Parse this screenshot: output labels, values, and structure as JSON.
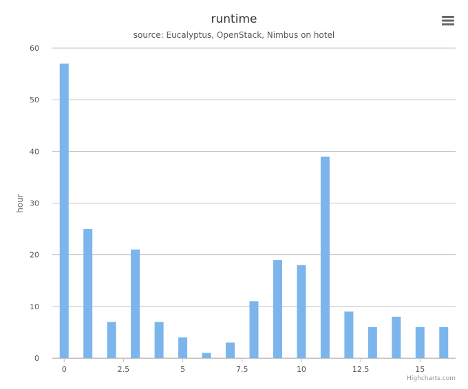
{
  "chart_data": {
    "type": "bar",
    "title": "runtime",
    "subtitle": "source: Eucalyptus, OpenStack, Nimbus on hotel",
    "xlabel": "",
    "ylabel": "hour",
    "x": [
      0,
      1,
      2,
      3,
      4,
      5,
      6,
      7,
      8,
      9,
      10,
      11,
      12,
      13,
      14,
      15,
      16
    ],
    "values": [
      57,
      25,
      7,
      21,
      7,
      4,
      1,
      3,
      11,
      19,
      18,
      39,
      9,
      6,
      8,
      6,
      6
    ],
    "xlim": [
      -0.5,
      16.5
    ],
    "ylim": [
      0,
      60
    ],
    "x_ticks": [
      "0",
      "2.5",
      "5",
      "7.5",
      "10",
      "12.5",
      "15"
    ],
    "x_tick_values": [
      0,
      2.5,
      5,
      7.5,
      10,
      12.5,
      15
    ],
    "y_ticks": [
      "0",
      "10",
      "20",
      "30",
      "40",
      "50",
      "60"
    ],
    "y_tick_values": [
      0,
      10,
      20,
      30,
      40,
      50,
      60
    ],
    "grid": true,
    "legend": "none",
    "bar_color": "#7cb5ec",
    "grid_color": "#c0c0c0"
  },
  "credits": "Highcharts.com",
  "menu_icon": "hamburger-menu-icon"
}
